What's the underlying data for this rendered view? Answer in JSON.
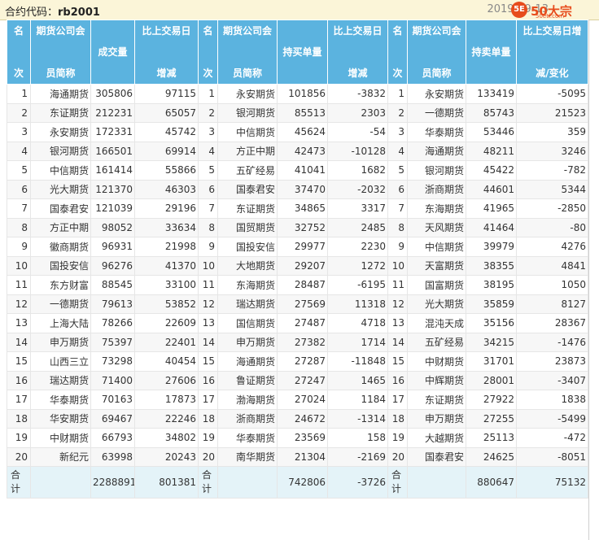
{
  "header": {
    "contract_label": "合约代码：",
    "contract_code": "rb2001",
    "date_partial": "2019-09-13",
    "logo_text": "50大宗",
    "logo_sub": "50etf.com",
    "logo_badge": "5E"
  },
  "columns": {
    "volume": {
      "rank": [
        "名",
        "次"
      ],
      "member": [
        "期货公司会",
        "员简称"
      ],
      "value": "成交量",
      "change": [
        "比上交易日",
        "增减"
      ]
    },
    "buy": {
      "rank": [
        "名",
        "次"
      ],
      "member": [
        "期货公司会",
        "员简称"
      ],
      "value": "持买单量",
      "change": [
        "比上交易日",
        "增减"
      ]
    },
    "sell": {
      "rank": [
        "名",
        "次"
      ],
      "member": [
        "期货公司会",
        "员简称"
      ],
      "value": "持卖单量",
      "change": [
        "比上交易日增",
        "减/变化"
      ]
    }
  },
  "colors": {
    "header_bg": "#5bb3df",
    "total_bg": "#e4f3f8",
    "topbar_bg": "#fbf5d8",
    "logo": "#e74c1c"
  },
  "chart_data": {
    "type": "table",
    "title": "合约代码：rb2001",
    "columns": [
      "名次",
      "期货公司会员简称",
      "成交量",
      "比上交易日增减",
      "名次",
      "期货公司会员简称",
      "持买单量",
      "比上交易日增减",
      "名次",
      "期货公司会员简称",
      "持卖单量",
      "比上交易日增减/变化"
    ],
    "rows": [
      [
        "1",
        "海通期货",
        "305806",
        "97115",
        "1",
        "永安期货",
        "101856",
        "-3832",
        "1",
        "永安期货",
        "133419",
        "-5095"
      ],
      [
        "2",
        "东证期货",
        "212231",
        "65057",
        "2",
        "银河期货",
        "85513",
        "2303",
        "2",
        "一德期货",
        "85743",
        "21523"
      ],
      [
        "3",
        "永安期货",
        "172331",
        "45742",
        "3",
        "中信期货",
        "45624",
        "-54",
        "3",
        "华泰期货",
        "53446",
        "359"
      ],
      [
        "4",
        "银河期货",
        "166501",
        "69914",
        "4",
        "方正中期",
        "42473",
        "-10128",
        "4",
        "海通期货",
        "48211",
        "3246"
      ],
      [
        "5",
        "中信期货",
        "161414",
        "55866",
        "5",
        "五矿经易",
        "41041",
        "1682",
        "5",
        "银河期货",
        "45422",
        "-782"
      ],
      [
        "6",
        "光大期货",
        "121370",
        "46303",
        "6",
        "国泰君安",
        "37470",
        "-2032",
        "6",
        "浙商期货",
        "44601",
        "5344"
      ],
      [
        "7",
        "国泰君安",
        "121039",
        "29196",
        "7",
        "东证期货",
        "34865",
        "3317",
        "7",
        "东海期货",
        "41965",
        "-2850"
      ],
      [
        "8",
        "方正中期",
        "98052",
        "33634",
        "8",
        "国贸期货",
        "32752",
        "2485",
        "8",
        "天风期货",
        "41464",
        "-80"
      ],
      [
        "9",
        "徽商期货",
        "96931",
        "21998",
        "9",
        "国投安信",
        "29977",
        "2230",
        "9",
        "中信期货",
        "39979",
        "4276"
      ],
      [
        "10",
        "国投安信",
        "96276",
        "41370",
        "10",
        "大地期货",
        "29207",
        "1272",
        "10",
        "天富期货",
        "38355",
        "4841"
      ],
      [
        "11",
        "东方财富",
        "88545",
        "33100",
        "11",
        "东海期货",
        "28487",
        "-6195",
        "11",
        "国富期货",
        "38195",
        "1050"
      ],
      [
        "12",
        "一德期货",
        "79613",
        "53852",
        "12",
        "瑞达期货",
        "27569",
        "11318",
        "12",
        "光大期货",
        "35859",
        "8127"
      ],
      [
        "13",
        "上海大陆",
        "78266",
        "22609",
        "13",
        "国信期货",
        "27487",
        "4718",
        "13",
        "混沌天成",
        "35156",
        "28367"
      ],
      [
        "14",
        "申万期货",
        "75397",
        "22401",
        "14",
        "申万期货",
        "27382",
        "1714",
        "14",
        "五矿经易",
        "34215",
        "-1476"
      ],
      [
        "15",
        "山西三立",
        "73298",
        "40454",
        "15",
        "海通期货",
        "27287",
        "-11848",
        "15",
        "中财期货",
        "31701",
        "23873"
      ],
      [
        "16",
        "瑞达期货",
        "71400",
        "27606",
        "16",
        "鲁证期货",
        "27247",
        "1465",
        "16",
        "中辉期货",
        "28001",
        "-3407"
      ],
      [
        "17",
        "华泰期货",
        "70163",
        "17873",
        "17",
        "渤海期货",
        "27024",
        "1184",
        "17",
        "东证期货",
        "27922",
        "1838"
      ],
      [
        "18",
        "华安期货",
        "69467",
        "22246",
        "18",
        "浙商期货",
        "24672",
        "-1314",
        "18",
        "申万期货",
        "27255",
        "-5499"
      ],
      [
        "19",
        "中财期货",
        "66793",
        "34802",
        "19",
        "华泰期货",
        "23569",
        "158",
        "19",
        "大越期货",
        "25113",
        "-472"
      ],
      [
        "20",
        "新纪元",
        "63998",
        "20243",
        "20",
        "南华期货",
        "21304",
        "-2169",
        "20",
        "国泰君安",
        "24625",
        "-8051"
      ]
    ],
    "totals": {
      "label": [
        "合",
        "计"
      ],
      "volume": "2288891",
      "volume_change": "801381",
      "buy": "742806",
      "buy_change": "-3726",
      "sell": "880647",
      "sell_change": "75132"
    }
  }
}
